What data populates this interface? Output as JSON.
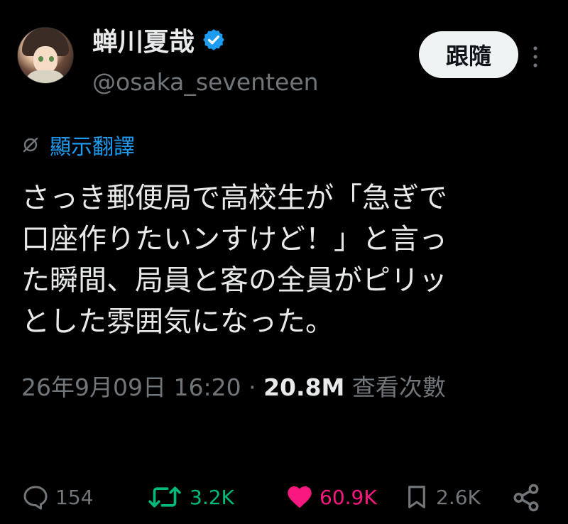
{
  "author": {
    "display_name": "蝉川夏哉",
    "handle": "@osaka_seventeen",
    "verified": true
  },
  "follow_label": "跟隨",
  "translate_label": "顯示翻譯",
  "tweet": {
    "lines": [
      "さっき郵便局で高校生が「急ぎで",
      "口座作りたいンすけど！」と言っ",
      "た瞬間、局員と客の全員がピリッ",
      "とした雰囲気になった。"
    ]
  },
  "meta": {
    "date": "26年9月09日",
    "time": "16:20",
    "separator": "·",
    "views": "20.8M",
    "views_label": "查看次數"
  },
  "actions": {
    "replies": "154",
    "retweets": "3.2K",
    "likes": "60.9K",
    "bookmarks": "2.6K"
  },
  "colors": {
    "background": "#000000",
    "text": "#e7e9ea",
    "muted": "#71767b",
    "link": "#1d9bf0",
    "retweet": "#00ba7c",
    "like": "#f91880",
    "verified": "#1d9bf0"
  }
}
